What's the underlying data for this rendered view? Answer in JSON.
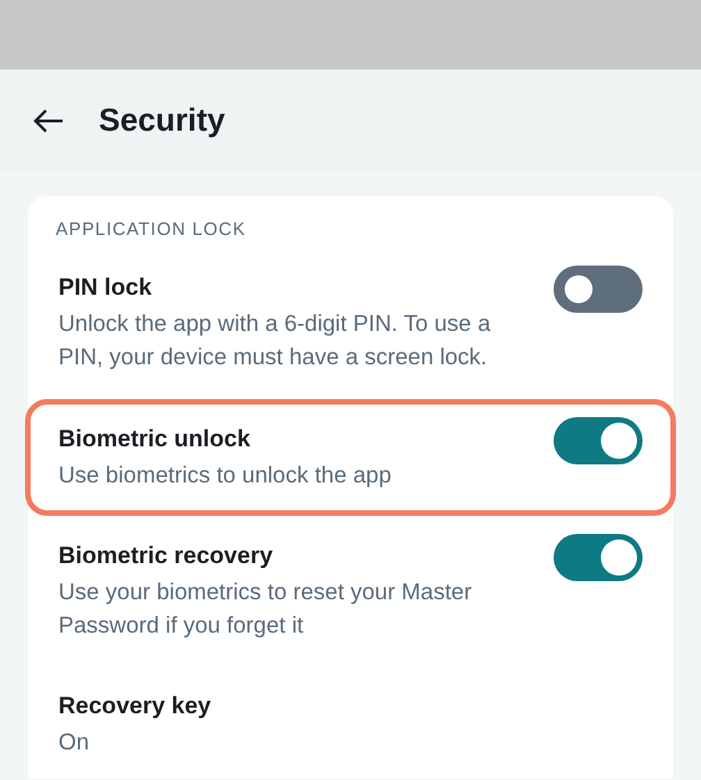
{
  "header": {
    "title": "Security"
  },
  "section": {
    "label": "APPLICATION LOCK",
    "items": [
      {
        "kind": "toggle",
        "title": "PIN lock",
        "description": "Unlock the app with a 6-digit PIN. To use a PIN, your device must have a screen lock.",
        "on": false,
        "highlighted": false
      },
      {
        "kind": "toggle",
        "title": "Biometric unlock",
        "description": "Use biometrics to unlock the app",
        "on": true,
        "highlighted": true
      },
      {
        "kind": "toggle",
        "title": "Biometric recovery",
        "description": "Use your biometrics to reset your Master Password if you forget it",
        "on": true,
        "highlighted": false
      },
      {
        "kind": "value",
        "title": "Recovery key",
        "description": "On",
        "highlighted": false
      }
    ]
  }
}
